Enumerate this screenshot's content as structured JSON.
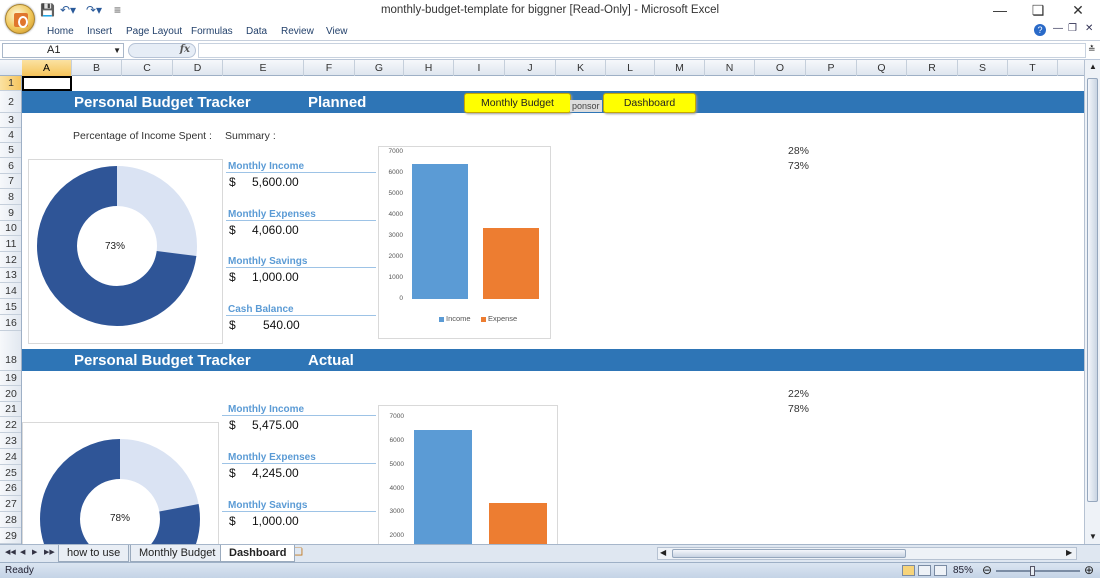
{
  "window": {
    "title": "monthly-budget-template for biggner  [Read-Only] - Microsoft Excel"
  },
  "ribbon": {
    "tabs": [
      "Home",
      "Insert",
      "Page Layout",
      "Formulas",
      "Data",
      "Review",
      "View"
    ]
  },
  "formula_bar": {
    "name_box": "A1",
    "fx_label": "fx",
    "formula": ""
  },
  "grid": {
    "columns": [
      "A",
      "B",
      "C",
      "D",
      "E",
      "F",
      "G",
      "H",
      "I",
      "J",
      "K",
      "L",
      "M",
      "N",
      "O",
      "P",
      "Q",
      "R",
      "S",
      "T"
    ],
    "rows": [
      "1",
      "2",
      "3",
      "4",
      "5",
      "6",
      "7",
      "8",
      "9",
      "10",
      "11",
      "12",
      "13",
      "14",
      "15",
      "16",
      "18",
      "19",
      "20",
      "21",
      "22",
      "23",
      "24",
      "25",
      "26",
      "27",
      "28",
      "29"
    ],
    "selected_cell": "A1"
  },
  "nav_buttons": {
    "monthly_budget": "Monthly Budget",
    "dashboard": "Dashboard",
    "hidden_button_fragment": "ponsor"
  },
  "planned": {
    "title": "Personal Budget Tracker",
    "subtitle": "Planned",
    "pct_label": "Percentage of Income Spent :",
    "summary_label": "Summary :",
    "donut_center": "73%",
    "donut_spent_fraction": 0.73,
    "monthly_income_label": "Monthly Income",
    "monthly_income": "5,600.00",
    "monthly_expenses_label": "Monthly Expenses",
    "monthly_expenses": "4,060.00",
    "monthly_savings_label": "Monthly Savings",
    "monthly_savings": "1,000.00",
    "cash_balance_label": "Cash Balance",
    "cash_balance": "540.00",
    "currency": "$",
    "pct_a": "28%",
    "pct_b": "73%"
  },
  "actual": {
    "title": "Personal Budget Tracker",
    "subtitle": "Actual",
    "donut_center": "78%",
    "donut_spent_fraction": 0.78,
    "monthly_income_label": "Monthly Income",
    "monthly_income": "5,475.00",
    "monthly_expenses_label": "Monthly Expenses",
    "monthly_expenses": "4,245.00",
    "monthly_savings_label": "Monthly Savings",
    "monthly_savings": "1,000.00",
    "currency": "$",
    "pct_a": "22%",
    "pct_b": "78%"
  },
  "chart_data": [
    {
      "type": "bar",
      "categories": [
        "Income",
        "Expense"
      ],
      "values": [
        6450,
        3400
      ],
      "ylim": [
        0,
        7000
      ],
      "yticks": [
        "0",
        "1000",
        "2000",
        "3000",
        "4000",
        "5000",
        "6000",
        "7000"
      ],
      "legend": [
        "Income",
        "Expense"
      ],
      "legend_position": "bottom",
      "colors": [
        "#5b9bd5",
        "#ed7d31"
      ]
    },
    {
      "type": "bar",
      "categories": [
        "Income",
        "Expense"
      ],
      "values": [
        6450,
        3400
      ],
      "ylim": [
        0,
        7000
      ],
      "yticks": [
        "2000",
        "3000",
        "4000",
        "5000",
        "6000",
        "7000"
      ],
      "colors": [
        "#5b9bd5",
        "#ed7d31"
      ]
    }
  ],
  "sheet_tabs": [
    "how to use",
    "Monthly Budget",
    "Dashboard"
  ],
  "active_tab": "Dashboard",
  "status": {
    "ready": "Ready",
    "zoom": "85%"
  },
  "colors": {
    "band": "#2e75b6",
    "label_blue": "#5b9bd5",
    "donut_dark": "#2f5597",
    "donut_light": "#dae3f3",
    "button_yellow": "#ffff00"
  }
}
